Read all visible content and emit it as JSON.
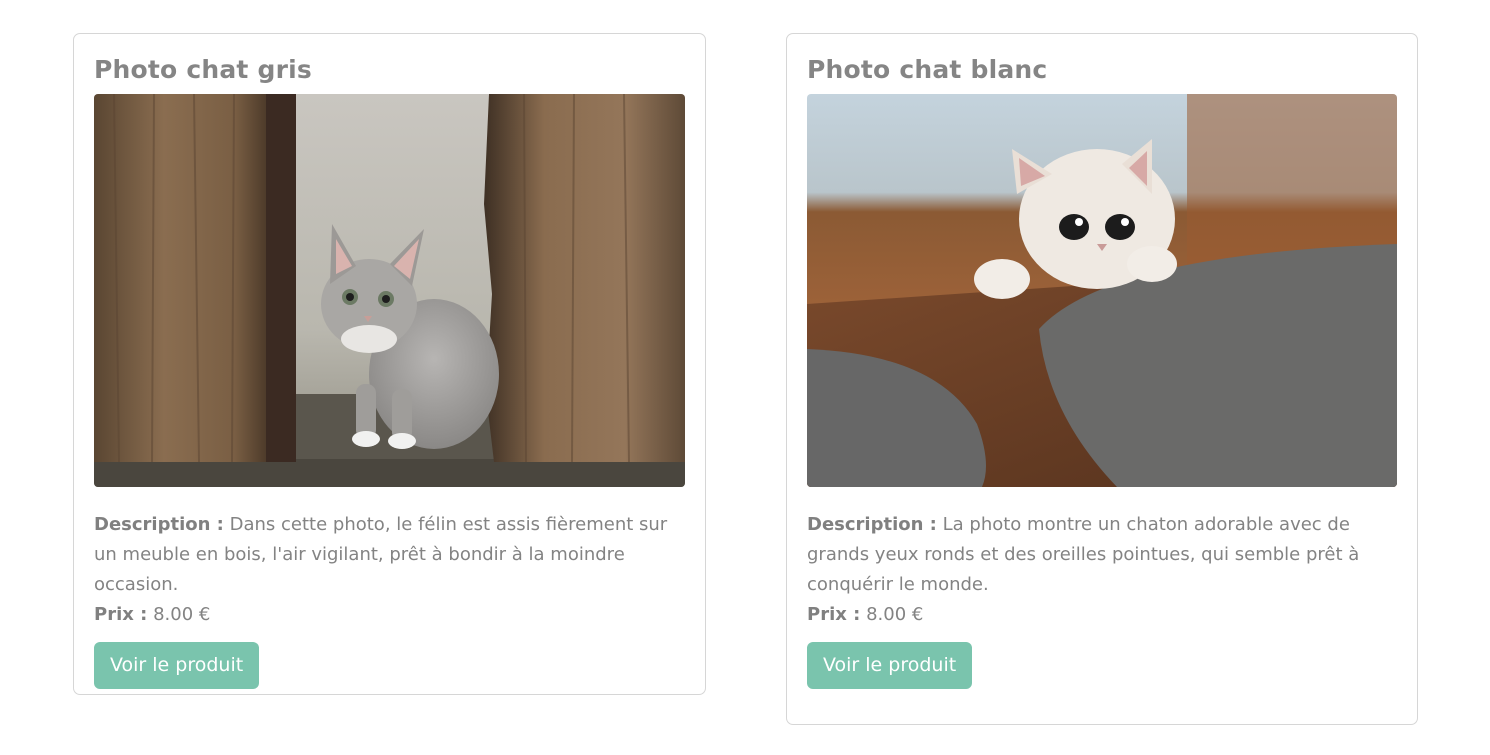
{
  "products": [
    {
      "title": "Photo chat gris",
      "image_alt_icon": "gray-kitten-photo",
      "description_label": "Description :",
      "description": "Dans cette photo, le félin est assis fièrement sur un meuble en bois, l'air vigilant, prêt à bondir à la moindre occasion.",
      "price_label": "Prix :",
      "price": "8.00 €",
      "button_label": "Voir le produit"
    },
    {
      "title": "Photo chat blanc",
      "image_alt_icon": "white-kitten-photo",
      "description_label": "Description :",
      "description": "La photo montre un chaton adorable avec de grands yeux ronds et des oreilles pointues, qui semble prêt à conquérir le monde.",
      "price_label": "Prix :",
      "price": "8.00 €",
      "button_label": "Voir le produit"
    }
  ],
  "colors": {
    "accent": "#7ac4ad",
    "text": "#838383",
    "border": "#d6d6d6"
  }
}
